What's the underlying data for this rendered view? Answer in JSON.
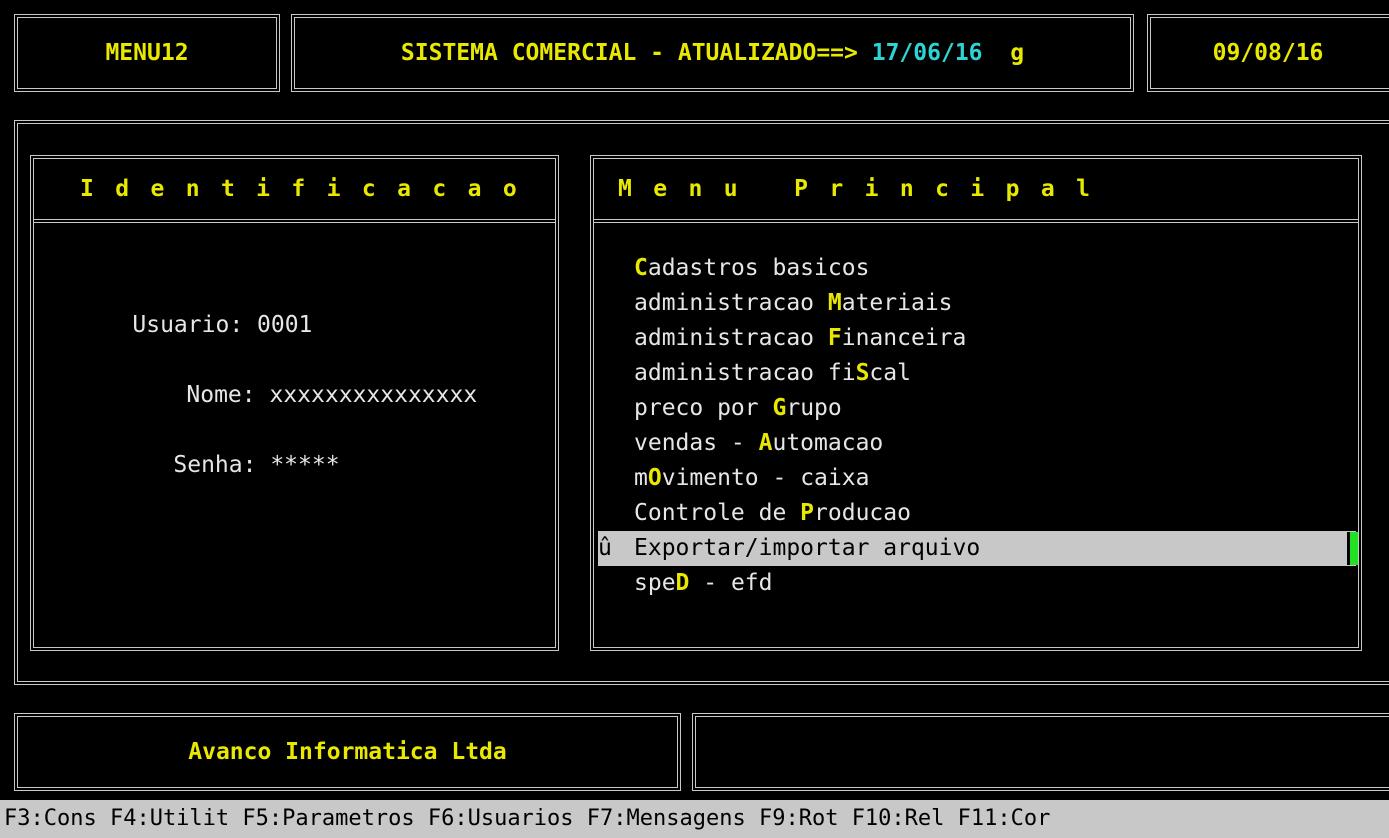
{
  "header": {
    "program": "MENU12",
    "system_title": "SISTEMA COMERCIAL - ATUALIZADO==> ",
    "update_date": "17/06/16",
    "flag": "g",
    "current_date": "09/08/16"
  },
  "identification": {
    "title": "Identificacao",
    "user_label": "Usuario: ",
    "user_value": "0001",
    "name_label": "Nome: ",
    "name_value": "xxxxxxxxxxxxxxx",
    "password_label": "Senha: ",
    "password_value": "*****"
  },
  "main_menu": {
    "title": "Menu  Principal",
    "selected_marker": "û",
    "items": [
      {
        "pre": "",
        "hot": "C",
        "post": "adastros basicos"
      },
      {
        "pre": "administracao ",
        "hot": "M",
        "post": "ateriais"
      },
      {
        "pre": "administracao ",
        "hot": "F",
        "post": "inanceira"
      },
      {
        "pre": "administracao fi",
        "hot": "S",
        "post": "cal"
      },
      {
        "pre": "preco por ",
        "hot": "G",
        "post": "rupo"
      },
      {
        "pre": "vendas - ",
        "hot": "A",
        "post": "utomacao"
      },
      {
        "pre": "m",
        "hot": "O",
        "post": "vimento - caixa"
      },
      {
        "pre": "Controle de ",
        "hot": "P",
        "post": "roducao"
      },
      {
        "pre": "",
        "hot": "E",
        "post": "xportar/importar arquivo"
      },
      {
        "pre": "spe",
        "hot": "D",
        "post": " - efd"
      }
    ],
    "selected_index": 8
  },
  "footer": {
    "company": "Avanco Informatica Ltda",
    "message": ""
  },
  "statusbar": {
    "keys": "F3:Cons F4:Utilit F5:Parametros F6:Usuarios F7:Mensagens F9:Rot F10:Rel F11:Cor"
  },
  "colors": {
    "background": "#000000",
    "highlight": "#e8e800",
    "accent": "#2ed3d3",
    "selection": "#c8c8c8",
    "cursor": "#22e022"
  }
}
